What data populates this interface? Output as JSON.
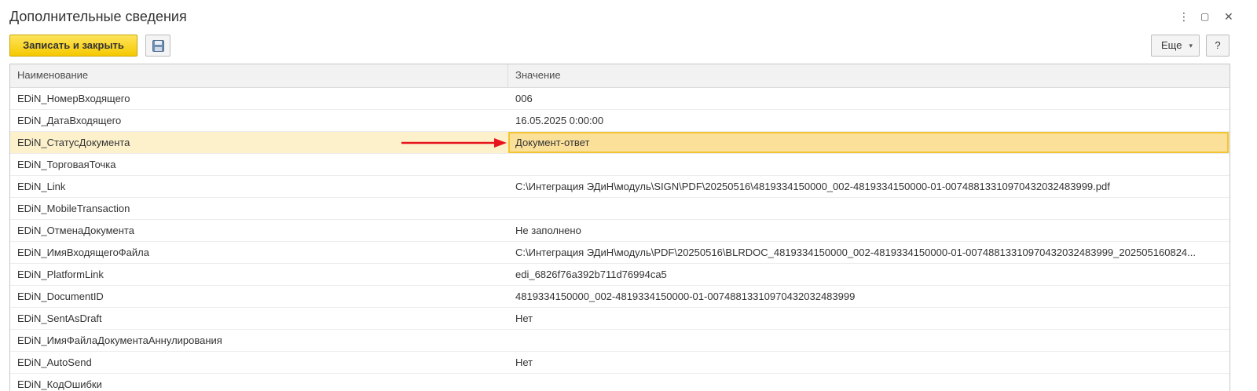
{
  "window": {
    "title": "Дополнительные сведения",
    "menu_icon": "⋮",
    "restore_icon": "▢",
    "close_icon": "✕"
  },
  "toolbar": {
    "save_close_label": "Записать и закрыть",
    "save_icon": "floppy-disk-icon",
    "more_label": "Еще",
    "more_caret": "▾",
    "help_label": "?"
  },
  "table": {
    "columns": [
      "Наименование",
      "Значение"
    ],
    "rows": [
      {
        "name": "EDiN_НомерВходящего",
        "value": "006"
      },
      {
        "name": "EDiN_ДатаВходящего",
        "value": "16.05.2025 0:00:00"
      },
      {
        "name": "EDiN_СтатусДокумента",
        "value": "Документ-ответ",
        "selected": true
      },
      {
        "name": "EDiN_ТорговаяТочка",
        "value": ""
      },
      {
        "name": "EDiN_Link",
        "value": "C:\\Интеграция ЭДиН\\модуль\\SIGN\\PDF\\20250516\\4819334150000_002-4819334150000-01-00748813310970432032483999.pdf"
      },
      {
        "name": "EDiN_MobileTransaction",
        "value": ""
      },
      {
        "name": "EDiN_ОтменаДокумента",
        "value": "Не заполнено"
      },
      {
        "name": "EDiN_ИмяВходящегоФайла",
        "value": "C:\\Интеграция ЭДиН\\модуль\\PDF\\20250516\\BLRDOC_4819334150000_002-4819334150000-01-00748813310970432032483999_202505160824..."
      },
      {
        "name": "EDiN_PlatformLink",
        "value": "edi_6826f76a392b711d76994ca5"
      },
      {
        "name": "EDiN_DocumentID",
        "value": "4819334150000_002-4819334150000-01-00748813310970432032483999"
      },
      {
        "name": "EDiN_SentAsDraft",
        "value": "Нет"
      },
      {
        "name": "EDiN_ИмяФайлаДокументаАннулирования",
        "value": ""
      },
      {
        "name": "EDiN_AutoSend",
        "value": "Нет"
      },
      {
        "name": "EDiN_КодОшибки",
        "value": ""
      }
    ]
  },
  "colors": {
    "accent_yellow": "#f5c900",
    "selection_bg": "#fdf1cc",
    "arrow_red": "#e8141b"
  }
}
